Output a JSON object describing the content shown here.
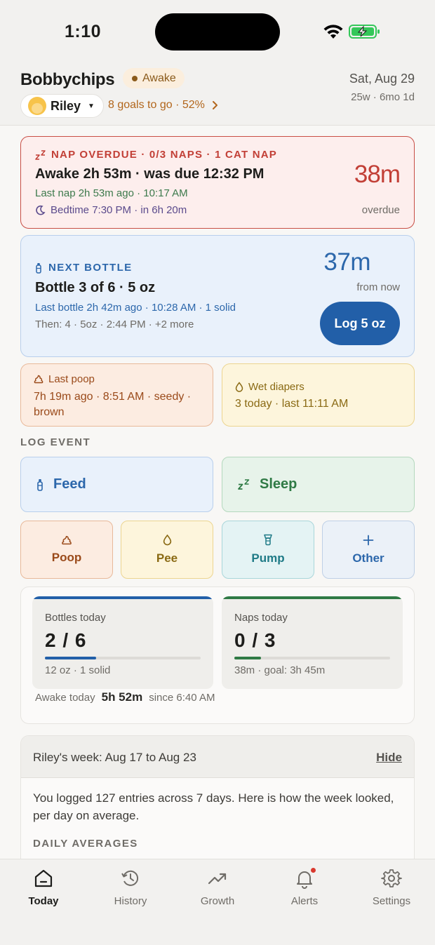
{
  "status_bar": {
    "time": "1:10"
  },
  "header": {
    "app_title": "Bobbychips",
    "state_badge": "Awake",
    "child_name": "Riley",
    "goals_text": "8 goals to go · 52%",
    "date": "Sat, Aug 29",
    "age": "25w · 6mo 1d"
  },
  "nap_card": {
    "heading": "NAP OVERDUE · 0/3 NAPS · 1 CAT NAP",
    "main": "Awake 2h 53m · was due 12:32 PM",
    "last_nap": "Last nap 2h 53m ago · 10:17 AM",
    "bedtime": "Bedtime 7:30 PM · in 6h 20m",
    "big_value": "38m",
    "big_caption": "overdue"
  },
  "bottle_card": {
    "heading": "NEXT BOTTLE",
    "main": "Bottle 3 of 6 · 5 oz",
    "last_bottle": "Last bottle 2h 42m ago · 10:28 AM · 1 solid",
    "then": "Then: 4 · 5oz · 2:44 PM  ·  +2 more",
    "big_value": "37m",
    "big_caption": "from now",
    "log_button": "Log 5 oz"
  },
  "poop_card": {
    "heading": "Last poop",
    "body": "7h 19m ago · 8:51 AM · seedy · brown"
  },
  "wet_card": {
    "heading": "Wet diapers",
    "body": "3 today · last 11:11 AM"
  },
  "log_event": {
    "label": "LOG EVENT",
    "feed": "Feed",
    "sleep": "Sleep",
    "poop": "Poop",
    "pee": "Pee",
    "pump": "Pump",
    "other": "Other"
  },
  "summary": {
    "bottles": {
      "label": "Bottles today",
      "value": "2 / 6",
      "progress": 0.33,
      "sub": "12 oz · 1 solid"
    },
    "naps": {
      "label": "Naps today",
      "value": "0 / 3",
      "progress": 0.17,
      "sub": "38m · goal: 3h 45m"
    },
    "awake_label": "Awake today",
    "awake_value": "5h 52m",
    "awake_since": "since 6:40 AM"
  },
  "week": {
    "title": "Riley's week: Aug 17 to Aug 23",
    "hide": "Hide",
    "text": "You logged 127 entries across 7 days. Here is how the week looked, per day on average.",
    "averages_label": "DAILY AVERAGES"
  },
  "tabs": [
    {
      "label": "Today",
      "icon": "home-icon",
      "active": true
    },
    {
      "label": "History",
      "icon": "history-icon",
      "active": false
    },
    {
      "label": "Growth",
      "icon": "trending-up-icon",
      "active": false
    },
    {
      "label": "Alerts",
      "icon": "bell-icon",
      "active": false,
      "badge": true
    },
    {
      "label": "Settings",
      "icon": "gear-icon",
      "active": false
    }
  ],
  "colors": {
    "overdue_red": "#c23f36",
    "bottle_blue": "#225fa8",
    "sleep_green": "#2f7a45",
    "poop_brown": "#9a4a1a",
    "pee_yellow": "#8a6a14",
    "pump_teal": "#1e7a86"
  }
}
